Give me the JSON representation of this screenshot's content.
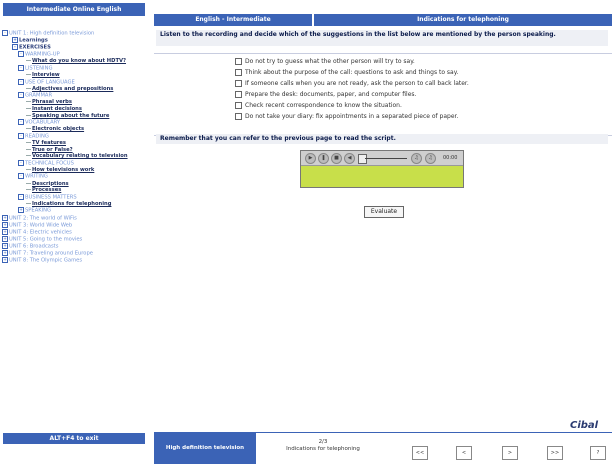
{
  "sidebar": {
    "header": "Intermediate Online English",
    "footer": "ALT+F4 to exit",
    "tree": [
      {
        "label": "UNIT 1: High definition television",
        "level": 0,
        "box": "-"
      },
      {
        "label": "Learnings",
        "level": 1,
        "box": "+"
      },
      {
        "label": "EXERCISES",
        "level": 1,
        "box": "-"
      },
      {
        "label": "WARMING-UP",
        "level": 2,
        "box": "-"
      },
      {
        "label": "What do you know about HDTV?",
        "level": 3
      },
      {
        "label": "LISTENING",
        "level": 2,
        "box": "-"
      },
      {
        "label": "Interview",
        "level": 3
      },
      {
        "label": "USE OF LANGUAGE",
        "level": 2,
        "box": "-"
      },
      {
        "label": "Adjectives and prepositions",
        "level": 3
      },
      {
        "label": "GRAMMAR",
        "level": 2,
        "box": "-"
      },
      {
        "label": "Phrasal verbs",
        "level": 3
      },
      {
        "label": "Instant decisions",
        "level": 3
      },
      {
        "label": "Speaking about the future",
        "level": 3
      },
      {
        "label": "VOCABULARY",
        "level": 2,
        "box": "-"
      },
      {
        "label": "Electronic objects",
        "level": 3
      },
      {
        "label": "READING",
        "level": 2,
        "box": "-"
      },
      {
        "label": "TV features",
        "level": 3
      },
      {
        "label": "True or False?",
        "level": 3
      },
      {
        "label": "Vocabulary relating to television",
        "level": 3
      },
      {
        "label": "TECHNICAL FOCUS",
        "level": 2,
        "box": "-"
      },
      {
        "label": "How televisions work",
        "level": 3
      },
      {
        "label": "WRITING",
        "level": 2,
        "box": "-"
      },
      {
        "label": "Descriptions",
        "level": 3
      },
      {
        "label": "Processes",
        "level": 3
      },
      {
        "label": "BUSINESS MATTERS",
        "level": 2,
        "box": "-"
      },
      {
        "label": "Indications for telephoning",
        "level": 3
      },
      {
        "label": "SPEAKING",
        "level": 2,
        "box": "+"
      },
      {
        "label": "UNIT 2: The world of WiFis",
        "level": 0,
        "box": "+"
      },
      {
        "label": "UNIT 3: World Wide Web",
        "level": 0,
        "box": "+"
      },
      {
        "label": "UNIT 4: Electric vehicles",
        "level": 0,
        "box": "+"
      },
      {
        "label": "UNIT 5: Going to the movies",
        "level": 0,
        "box": "+"
      },
      {
        "label": "UNIT 6: Broadcasts",
        "level": 0,
        "box": "+"
      },
      {
        "label": "UNIT 7: Traveling around Europe",
        "level": 0,
        "box": "+"
      },
      {
        "label": "UNIT 8: The Olympic Games",
        "level": 0,
        "box": "+"
      }
    ]
  },
  "header": {
    "left_tab": "English - Intermediate",
    "right_tab": "Indications for telephoning"
  },
  "exercise": {
    "instruction": "Listen to the recording and decide which of the suggestions in the list below are mentioned by the person speaking.",
    "options": [
      "Do not try to guess what the other person will try to say.",
      "Think about the purpose of the call: questions to ask and things to say.",
      "If someone calls when you are not ready, ask the person to call back later.",
      "Prepare the desk: documents, paper, and computer files.",
      "Check recent correspondence to know the situation.",
      "Do not take your diary: fix appointments in a separated piece of paper."
    ],
    "remember": "Remember that you can refer to the previous page to read the script.",
    "evaluate_label": "Evaluate"
  },
  "player": {
    "time": "00:00"
  },
  "brand": "Cibal",
  "footer": {
    "course": "High definition television",
    "page_number": "2/3",
    "page_title": "Indications for telephoning",
    "buttons": [
      "<<",
      "<",
      ">",
      ">>",
      "?"
    ]
  },
  "colors": {
    "accent": "#3b63b6",
    "player_area": "#c8df4a",
    "panel_bg": "#eef0f5"
  }
}
